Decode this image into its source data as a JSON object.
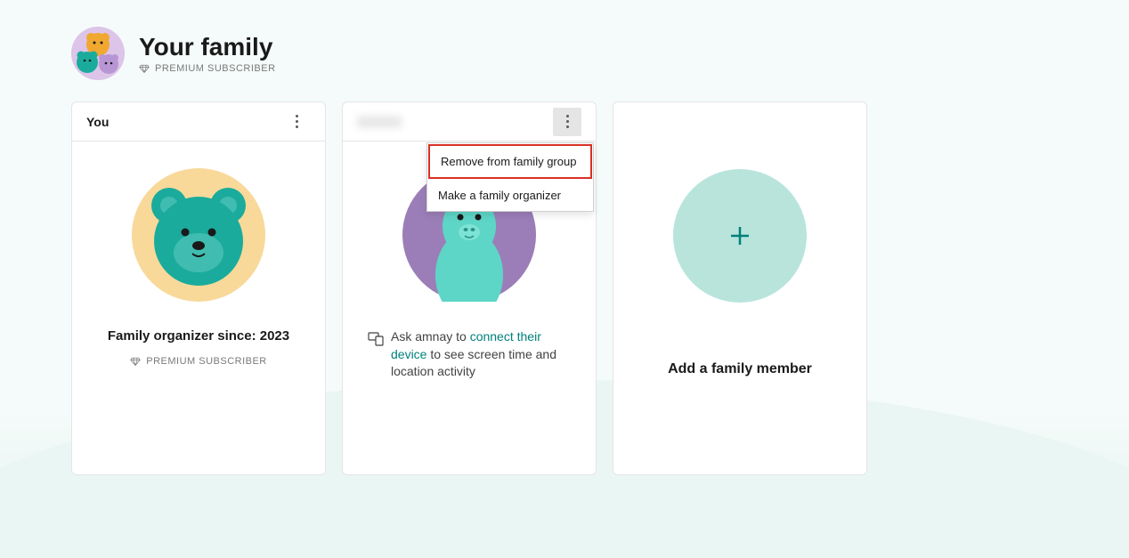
{
  "header": {
    "title": "Your family",
    "subscriber_label": "PREMIUM SUBSCRIBER"
  },
  "cards": {
    "you": {
      "title": "You",
      "organizer_text": "Family organizer since: 2023",
      "premium_label": "PREMIUM SUBSCRIBER"
    },
    "member": {
      "ask_prefix": "Ask amnay to ",
      "ask_link": "connect their device",
      "ask_suffix": " to see screen time and location activity"
    },
    "add": {
      "label": "Add a family member"
    }
  },
  "menu": {
    "remove": "Remove from family group",
    "make_organizer": "Make a family organizer"
  }
}
